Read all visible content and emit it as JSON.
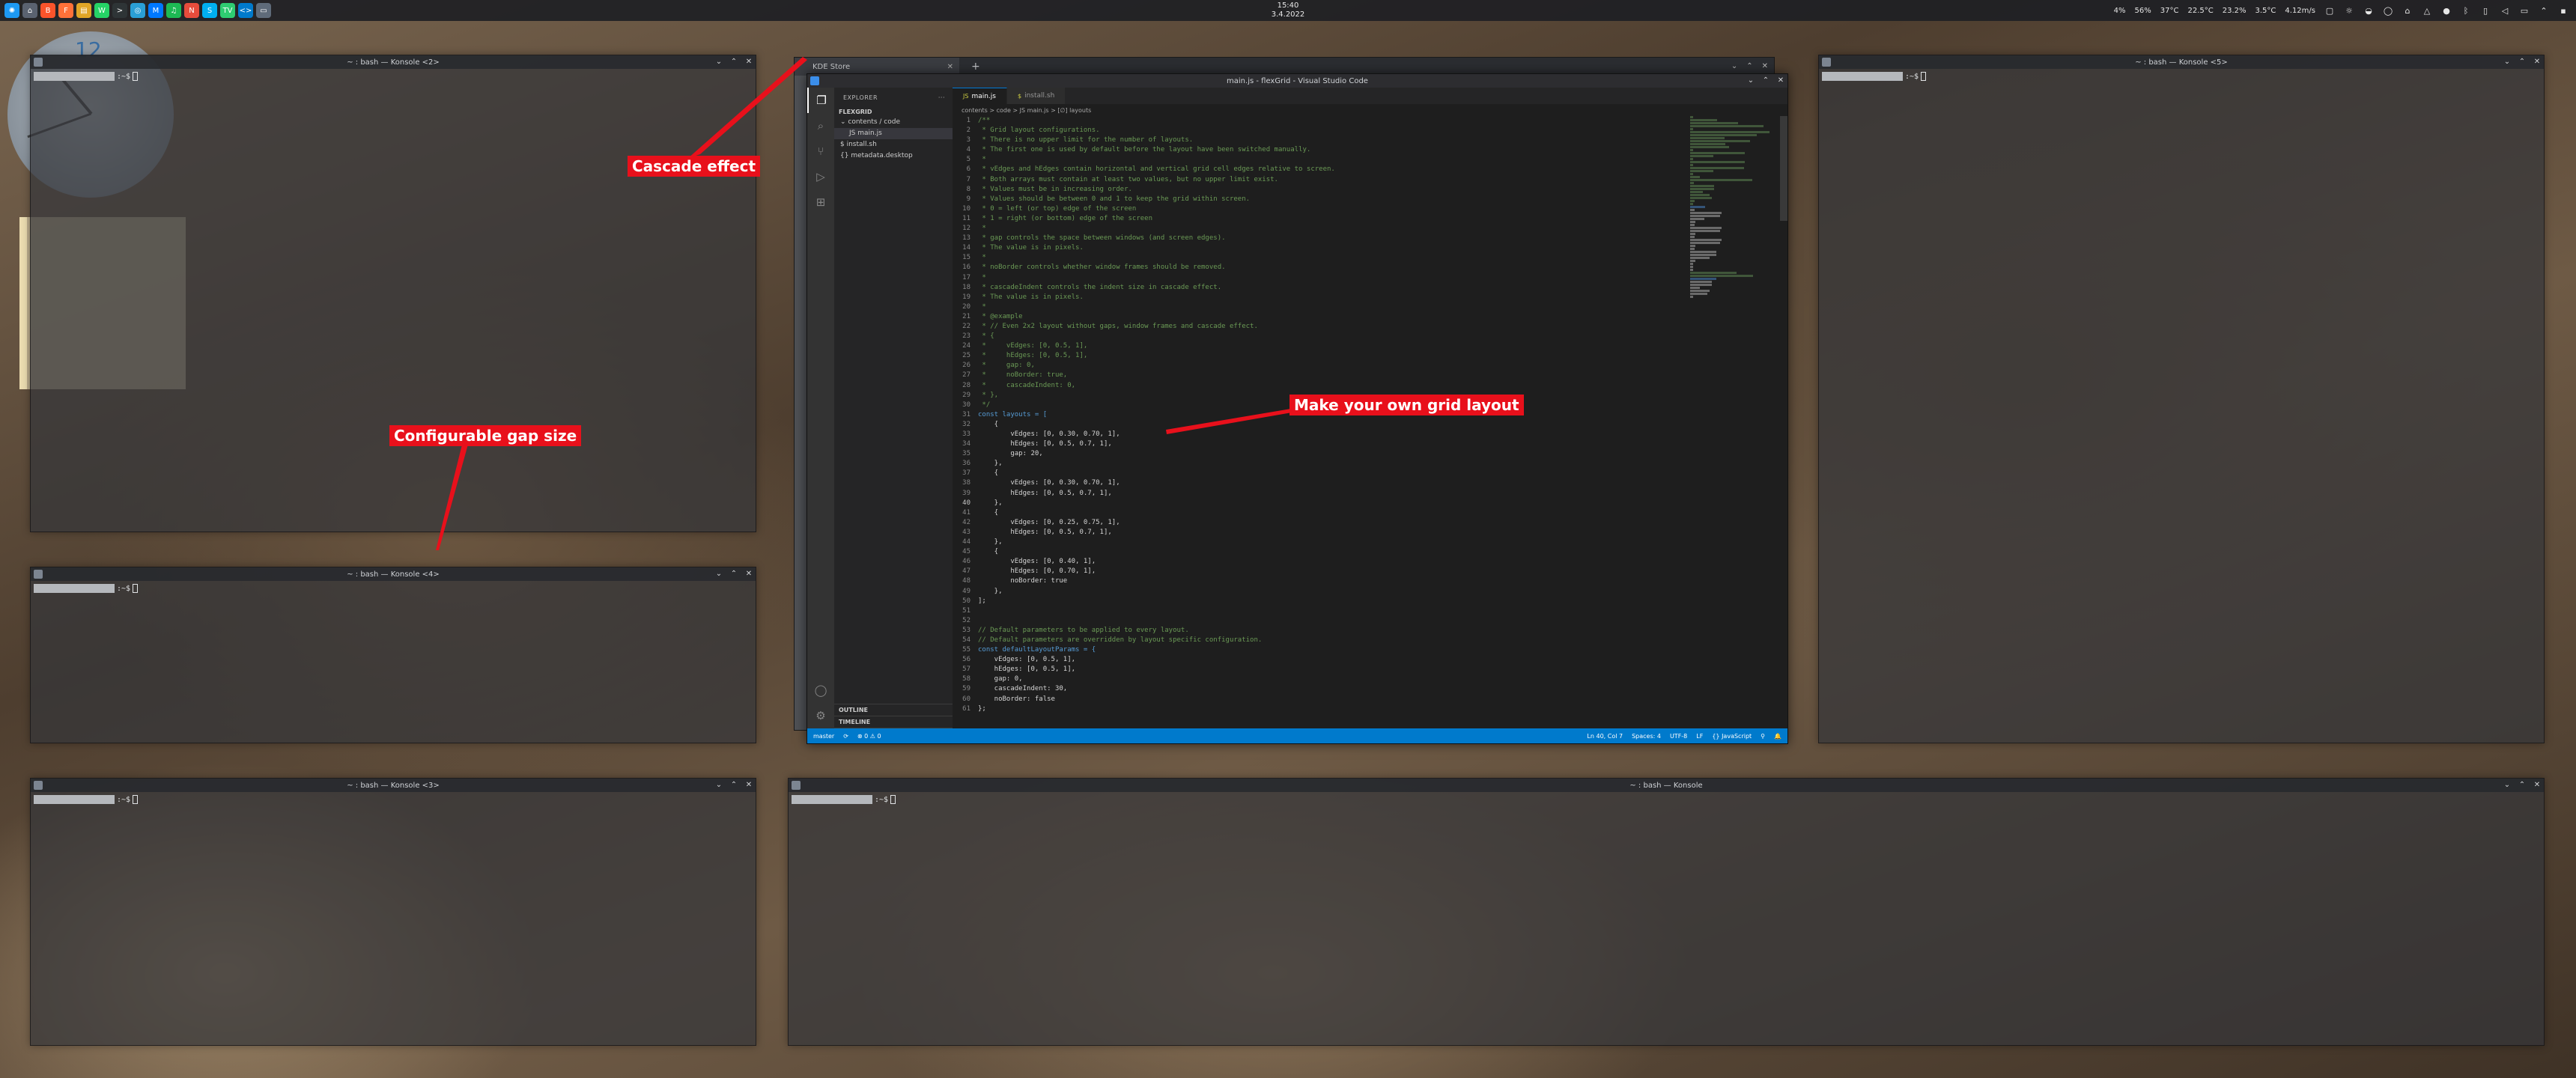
{
  "panel": {
    "clock_time": "15:40",
    "clock_date": "3.4.2022",
    "launchers": [
      {
        "name": "kde-menu-icon",
        "glyph": "✺",
        "color": "#1d99f3"
      },
      {
        "name": "home-icon",
        "glyph": "⌂",
        "color": "#5a6270"
      },
      {
        "name": "brave-icon",
        "glyph": "B",
        "color": "#fb542b"
      },
      {
        "name": "firefox-icon",
        "glyph": "F",
        "color": "#ff7139"
      },
      {
        "name": "files-icon",
        "glyph": "▤",
        "color": "#e0a526"
      },
      {
        "name": "whatsapp-icon",
        "glyph": "W",
        "color": "#25d366"
      },
      {
        "name": "terminal-icon",
        "glyph": ">",
        "color": "#2e3436"
      },
      {
        "name": "browser-icon",
        "glyph": "◎",
        "color": "#2a9fd6"
      },
      {
        "name": "messenger-icon",
        "glyph": "M",
        "color": "#0078ff"
      },
      {
        "name": "spotify-icon",
        "glyph": "♫",
        "color": "#1db954"
      },
      {
        "name": "notes-icon",
        "glyph": "N",
        "color": "#e74c3c"
      },
      {
        "name": "skype-icon",
        "glyph": "S",
        "color": "#00aff0"
      },
      {
        "name": "tv-icon",
        "glyph": "TV",
        "color": "#2ecc71"
      },
      {
        "name": "code-task-icon",
        "glyph": "<>",
        "color": "#007acc"
      },
      {
        "name": "window-task-icon",
        "glyph": "▭",
        "color": "#5f6b7a"
      }
    ],
    "tray_texts": [
      "4%",
      "56%",
      "37°C",
      "22.5°C",
      "23.2%",
      "3.5°C",
      "4.12m/s"
    ],
    "tray_icons": [
      {
        "name": "folder-icon",
        "glyph": "▢"
      },
      {
        "name": "weather-icon",
        "glyph": "☼"
      },
      {
        "name": "bulb-icon",
        "glyph": "◒"
      },
      {
        "name": "bulb-icon-2",
        "glyph": "◯"
      },
      {
        "name": "network-icon",
        "glyph": "⌂"
      },
      {
        "name": "bell-icon",
        "glyph": "△"
      },
      {
        "name": "record-icon",
        "glyph": "●"
      },
      {
        "name": "bluetooth-icon",
        "glyph": "ᛒ"
      },
      {
        "name": "battery-icon",
        "glyph": "▯"
      },
      {
        "name": "volume-icon",
        "glyph": "◁"
      },
      {
        "name": "display-icon",
        "glyph": "▭"
      },
      {
        "name": "chevron-up-icon",
        "glyph": "⌃"
      },
      {
        "name": "desktop-icon",
        "glyph": "▪"
      }
    ]
  },
  "konsole": {
    "title_2": "~ : bash — Konsole <2>",
    "title_3": "~ : bash — Konsole <3>",
    "title_4": "~ : bash — Konsole <4>",
    "title_5": "~ : bash — Konsole <5>",
    "title_main": "~ : bash — Konsole",
    "prompt_symbol": ":~$"
  },
  "discover": {
    "tab_label": "KDE Store"
  },
  "vscode": {
    "title": "main.js - flexGrid - Visual Studio Code",
    "explorer_label": "EXPLORER",
    "folder_label": "FLEXGRID",
    "tree": [
      {
        "label": "⌄ contents / code",
        "indent": 8,
        "selected": false
      },
      {
        "label": "JS main.js",
        "indent": 20,
        "selected": true
      },
      {
        "label": "$ install.sh",
        "indent": 8,
        "selected": false
      },
      {
        "label": "{} metadata.desktop",
        "indent": 8,
        "selected": false
      }
    ],
    "outline_label": "OUTLINE",
    "timeline_label": "TIMELINE",
    "tabs": [
      {
        "label": "main.js",
        "ext": "JS",
        "active": true
      },
      {
        "label": "install.sh",
        "ext": "$",
        "active": false
      }
    ],
    "breadcrumb": "contents > code > JS main.js > [∅] layouts",
    "current_line": 40,
    "lines": [
      {
        "n": "1",
        "t": "/**",
        "k": "com"
      },
      {
        "n": "2",
        "t": " * Grid layout configurations.",
        "k": "com"
      },
      {
        "n": "3",
        "t": " * There is no upper limit for the number of layouts.",
        "k": "com"
      },
      {
        "n": "4",
        "t": " * The first one is used by default before the layout have been switched manually.",
        "k": "com"
      },
      {
        "n": "5",
        "t": " *",
        "k": "com"
      },
      {
        "n": "6",
        "t": " * vEdges and hEdges contain horizontal and vertical grid cell edges relative to screen.",
        "k": "com"
      },
      {
        "n": "7",
        "t": " * Both arrays must contain at least two values, but no upper limit exist.",
        "k": "com"
      },
      {
        "n": "8",
        "t": " * Values must be in increasing order.",
        "k": "com"
      },
      {
        "n": "9",
        "t": " * Values should be between 0 and 1 to keep the grid within screen.",
        "k": "com"
      },
      {
        "n": "10",
        "t": " * 0 = left (or top) edge of the screen",
        "k": "com"
      },
      {
        "n": "11",
        "t": " * 1 = right (or bottom) edge of the screen",
        "k": "com"
      },
      {
        "n": "12",
        "t": " *",
        "k": "com"
      },
      {
        "n": "13",
        "t": " * gap controls the space between windows (and screen edges).",
        "k": "com"
      },
      {
        "n": "14",
        "t": " * The value is in pixels.",
        "k": "com"
      },
      {
        "n": "15",
        "t": " *",
        "k": "com"
      },
      {
        "n": "16",
        "t": " * noBorder controls whether window frames should be removed.",
        "k": "com"
      },
      {
        "n": "17",
        "t": " *",
        "k": "com"
      },
      {
        "n": "18",
        "t": " * cascadeIndent controls the indent size in cascade effect.",
        "k": "com"
      },
      {
        "n": "19",
        "t": " * The value is in pixels.",
        "k": "com"
      },
      {
        "n": "20",
        "t": " *",
        "k": "com"
      },
      {
        "n": "21",
        "t": " * @example",
        "k": "com"
      },
      {
        "n": "22",
        "t": " * // Even 2x2 layout without gaps, window frames and cascade effect.",
        "k": "com"
      },
      {
        "n": "23",
        "t": " * {",
        "k": "com"
      },
      {
        "n": "24",
        "t": " *     vEdges: [0, 0.5, 1],",
        "k": "com"
      },
      {
        "n": "25",
        "t": " *     hEdges: [0, 0.5, 1],",
        "k": "com"
      },
      {
        "n": "26",
        "t": " *     gap: 0,",
        "k": "com"
      },
      {
        "n": "27",
        "t": " *     noBorder: true,",
        "k": "com"
      },
      {
        "n": "28",
        "t": " *     cascadeIndent: 0,",
        "k": "com"
      },
      {
        "n": "29",
        "t": " * },",
        "k": "com"
      },
      {
        "n": "30",
        "t": " */",
        "k": "com"
      },
      {
        "n": "31",
        "t": "const layouts = [",
        "k": "kw"
      },
      {
        "n": "32",
        "t": "    {",
        "k": "txt"
      },
      {
        "n": "33",
        "t": "        vEdges: [0, 0.30, 0.70, 1],",
        "k": "txt"
      },
      {
        "n": "34",
        "t": "        hEdges: [0, 0.5, 0.7, 1],",
        "k": "txt"
      },
      {
        "n": "35",
        "t": "        gap: 20,",
        "k": "txt"
      },
      {
        "n": "36",
        "t": "    },",
        "k": "txt"
      },
      {
        "n": "37",
        "t": "    {",
        "k": "txt"
      },
      {
        "n": "38",
        "t": "        vEdges: [0, 0.30, 0.70, 1],",
        "k": "txt"
      },
      {
        "n": "39",
        "t": "        hEdges: [0, 0.5, 0.7, 1],",
        "k": "txt"
      },
      {
        "n": "40",
        "t": "    },",
        "k": "txt"
      },
      {
        "n": "41",
        "t": "    {",
        "k": "txt"
      },
      {
        "n": "42",
        "t": "        vEdges: [0, 0.25, 0.75, 1],",
        "k": "txt"
      },
      {
        "n": "43",
        "t": "        hEdges: [0, 0.5, 0.7, 1],",
        "k": "txt"
      },
      {
        "n": "44",
        "t": "    },",
        "k": "txt"
      },
      {
        "n": "45",
        "t": "    {",
        "k": "txt"
      },
      {
        "n": "46",
        "t": "        vEdges: [0, 0.40, 1],",
        "k": "txt"
      },
      {
        "n": "47",
        "t": "        hEdges: [0, 0.70, 1],",
        "k": "txt"
      },
      {
        "n": "48",
        "t": "        noBorder: true",
        "k": "txt"
      },
      {
        "n": "49",
        "t": "    },",
        "k": "txt"
      },
      {
        "n": "50",
        "t": "];",
        "k": "txt"
      },
      {
        "n": "51",
        "t": "",
        "k": "txt"
      },
      {
        "n": "52",
        "t": "",
        "k": "txt"
      },
      {
        "n": "53",
        "t": "// Default parameters to be applied to every layout.",
        "k": "com"
      },
      {
        "n": "54",
        "t": "// Default parameters are overridden by layout specific configuration.",
        "k": "com"
      },
      {
        "n": "55",
        "t": "const defaultLayoutParams = {",
        "k": "kw"
      },
      {
        "n": "56",
        "t": "    vEdges: [0, 0.5, 1],",
        "k": "txt"
      },
      {
        "n": "57",
        "t": "    hEdges: [0, 0.5, 1],",
        "k": "txt"
      },
      {
        "n": "58",
        "t": "    gap: 0,",
        "k": "txt"
      },
      {
        "n": "59",
        "t": "    cascadeIndent: 30,",
        "k": "txt"
      },
      {
        "n": "60",
        "t": "    noBorder: false",
        "k": "txt"
      },
      {
        "n": "61",
        "t": "};",
        "k": "txt"
      }
    ],
    "status_left": [
      "master",
      "⟳",
      "⊗ 0 ⚠ 0"
    ],
    "status_right": [
      "Ln 40, Col 7",
      "Spaces: 4",
      "UTF-8",
      "LF",
      "{} JavaScript",
      "⚲",
      "🔔"
    ]
  },
  "annotations": {
    "cascade": "Cascade effect",
    "gap": "Configurable gap size",
    "grid": "Make your own grid layout"
  }
}
